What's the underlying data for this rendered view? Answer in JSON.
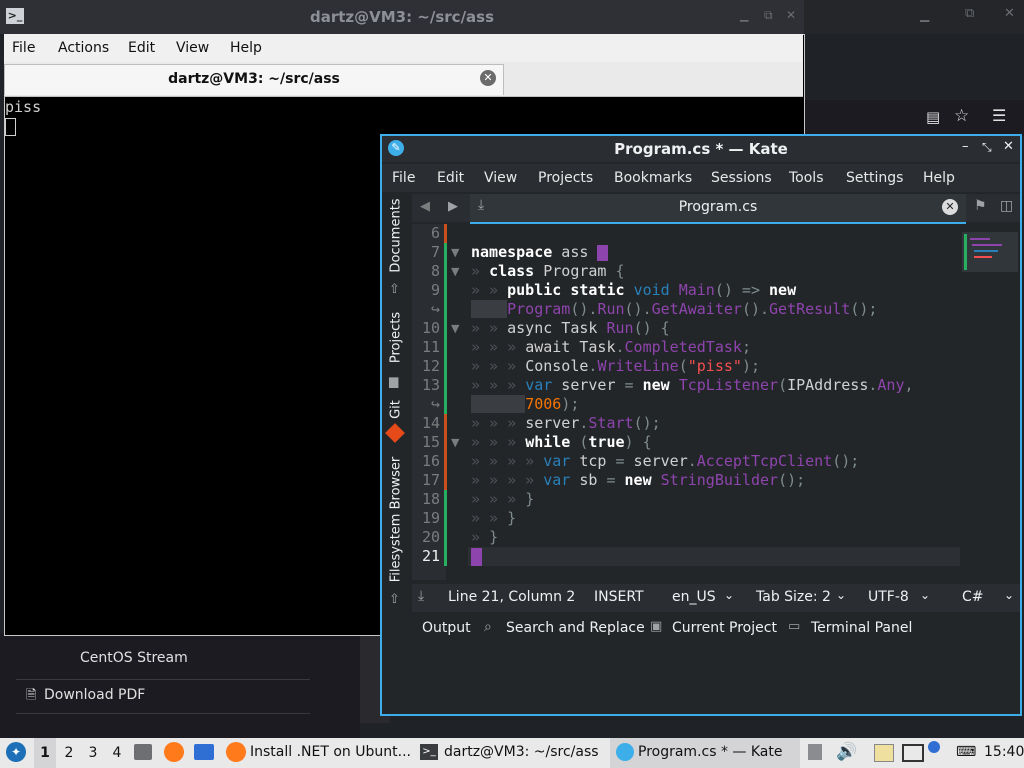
{
  "terminal": {
    "title": "dartz@VM3: ~/src/ass",
    "menu": [
      "File",
      "Actions",
      "Edit",
      "View",
      "Help"
    ],
    "tab_label": "dartz@VM3: ~/src/ass",
    "output": "piss"
  },
  "browser_background": {
    "sidebar_text": "CentOS Stream",
    "download_label": "Download PDF"
  },
  "kate": {
    "title": "Program.cs * — Kate",
    "menu": [
      "File",
      "Edit",
      "View",
      "Projects",
      "Bookmarks",
      "Sessions",
      "Tools",
      "Settings",
      "Help"
    ],
    "side_panels": [
      "Documents",
      "Projects",
      "Git",
      "Filesystem Browser"
    ],
    "doc_tab": "Program.cs",
    "line_numbers": [
      "6",
      "7",
      "8",
      "9",
      "",
      "10",
      "11",
      "12",
      "13",
      "",
      "14",
      "15",
      "16",
      "17",
      "18",
      "19",
      "20",
      "21"
    ],
    "status": {
      "position": "Line 21, Column 2",
      "mode": "INSERT",
      "language_dict": "en_US",
      "tab_size": "Tab Size: 2",
      "encoding": "UTF-8",
      "syntax": "C#"
    },
    "bottom_tools": [
      "Output",
      "Search and Replace",
      "Current Project",
      "Terminal Panel"
    ]
  },
  "taskbar": {
    "workspaces": [
      "1",
      "2",
      "3",
      "4"
    ],
    "tasks": [
      "Install .NET on Ubunt...",
      "dartz@VM3: ~/src/ass",
      "Program.cs * — Kate"
    ],
    "clock": "15:40"
  },
  "colors": {
    "kate_accent": "#3daee9",
    "keyword": "#ffffff",
    "type": "#2980b9",
    "function": "#8e44ad",
    "string": "#f44f4f",
    "number": "#f67400",
    "modified_marker": "#c9501c",
    "saved_marker": "#27ae60"
  }
}
